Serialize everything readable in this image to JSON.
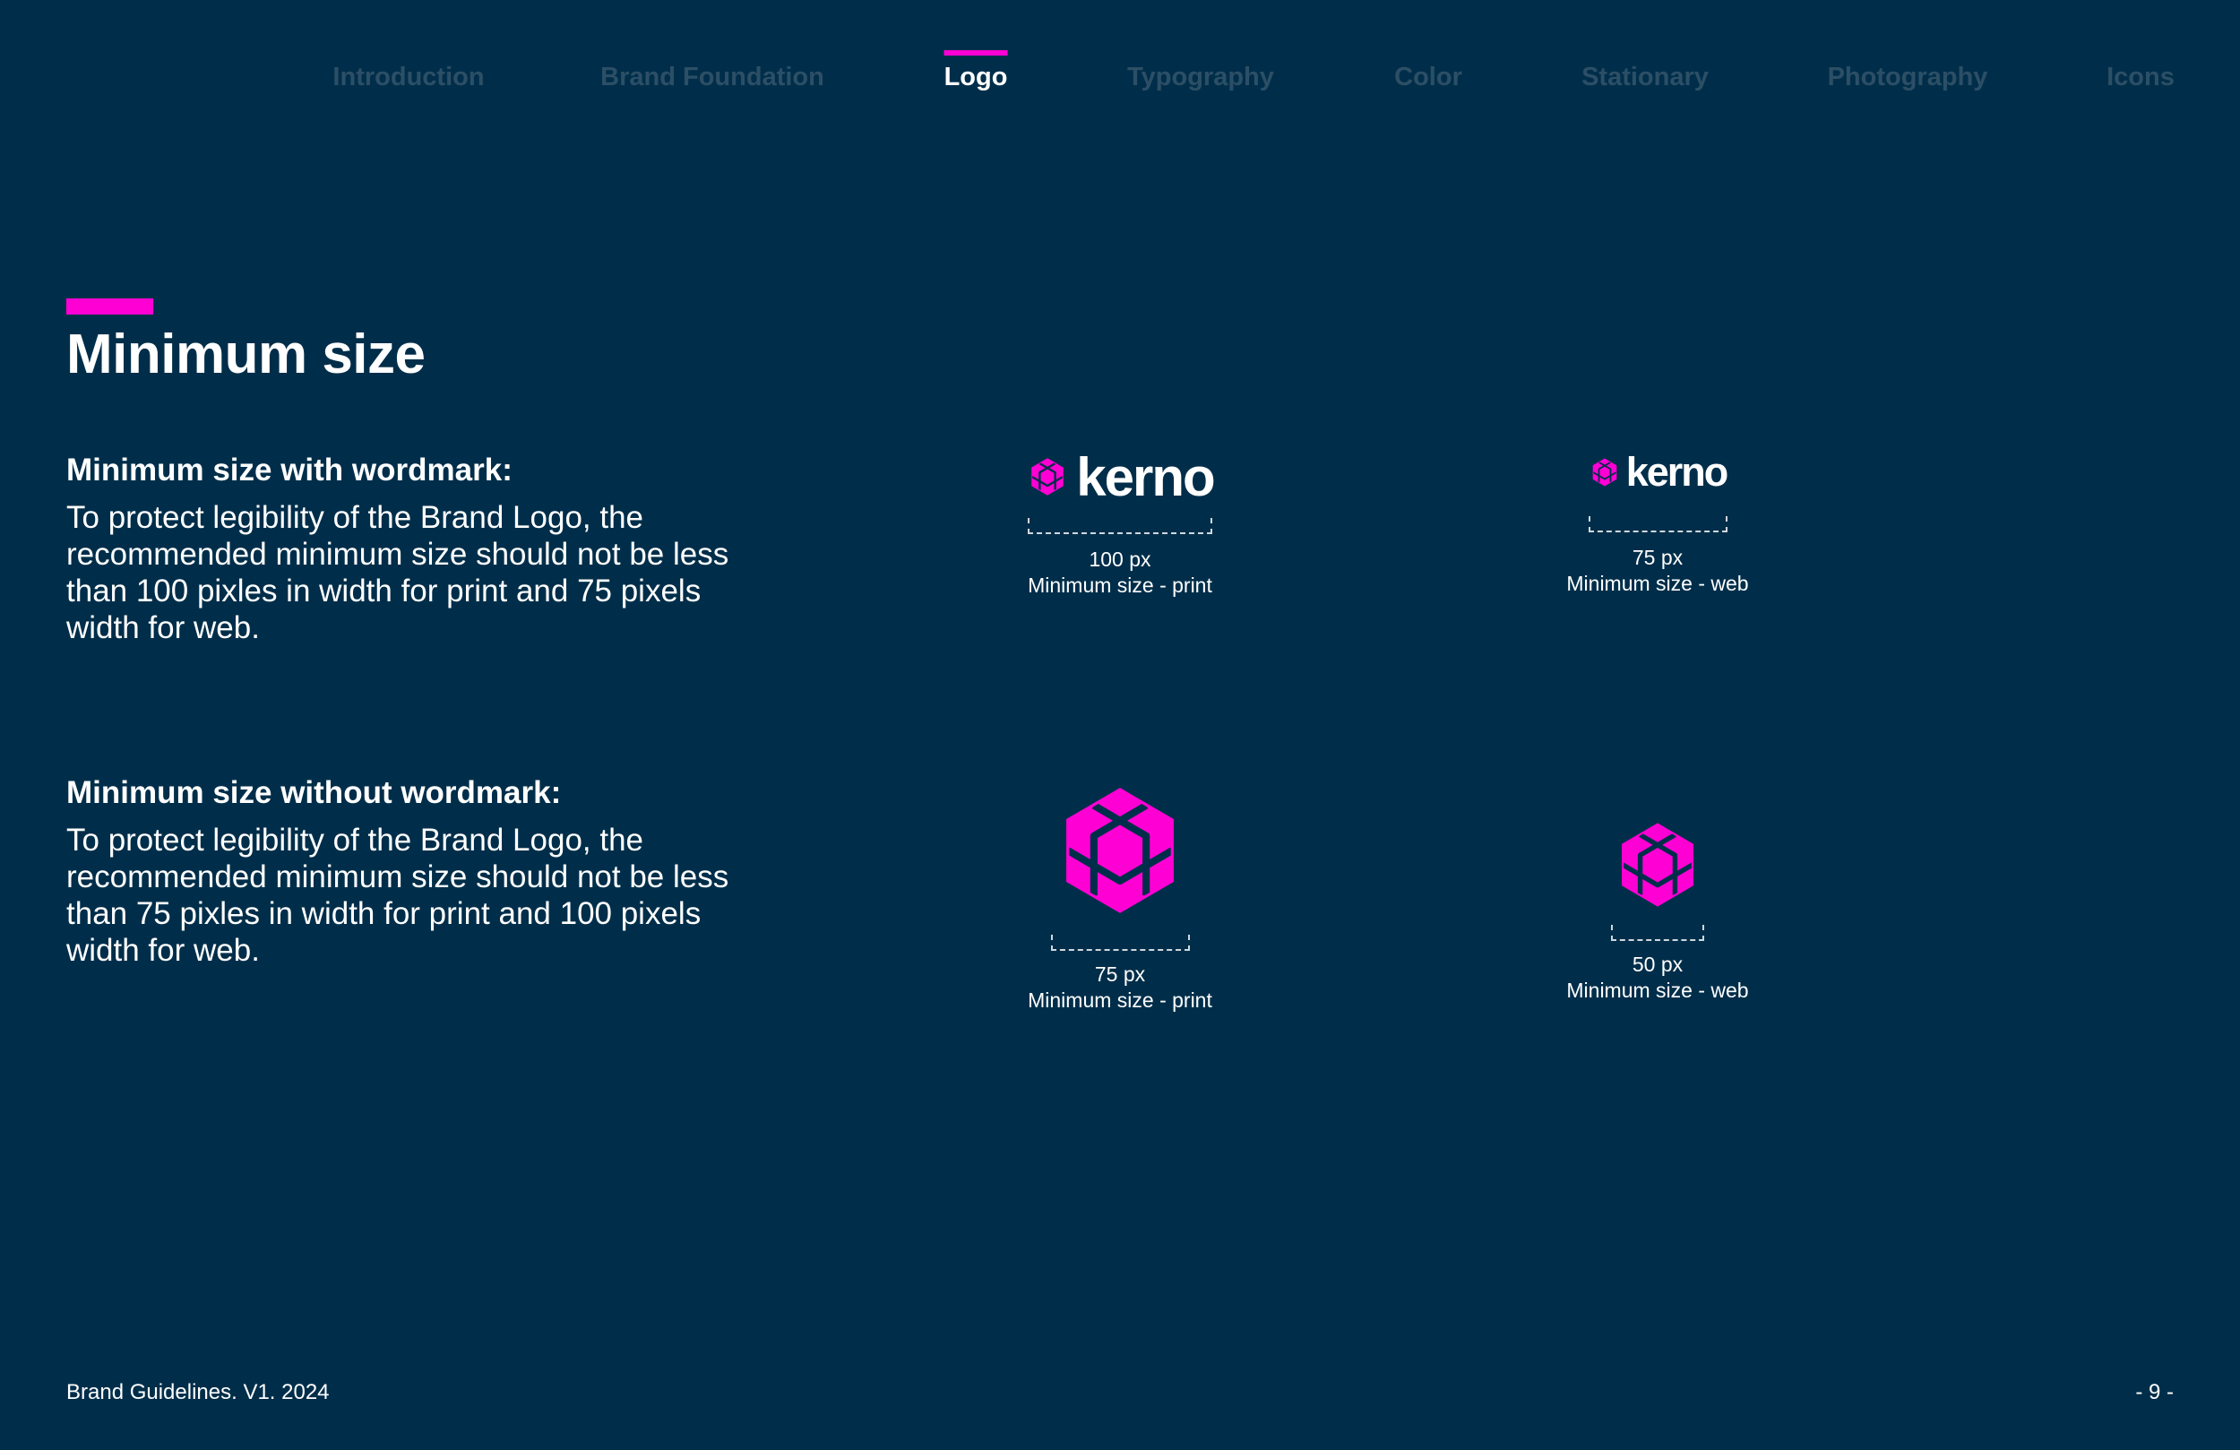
{
  "nav": {
    "items": [
      {
        "label": "Introduction",
        "active": false
      },
      {
        "label": "Brand Foundation",
        "active": false
      },
      {
        "label": "Logo",
        "active": true
      },
      {
        "label": "Typography",
        "active": false
      },
      {
        "label": "Color",
        "active": false
      },
      {
        "label": "Stationary",
        "active": false
      },
      {
        "label": "Photography",
        "active": false
      },
      {
        "label": "Icons",
        "active": false
      }
    ]
  },
  "page": {
    "title": "Minimum size"
  },
  "sections": [
    {
      "heading": "Minimum size with wordmark:",
      "body": "To protect legibility of the Brand Logo, the recommended minimum size should not be less than 100 pixles in width for print and 75 pixels width for web."
    },
    {
      "heading": "Minimum size without wordmark:",
      "body": "To protect legibility of the Brand Logo, the recommended minimum size should not be less than 75 pixles in width for print and 100 pixels width for web."
    }
  ],
  "logos": {
    "wordmark_text": "kerno",
    "examples": [
      {
        "size": "100 px",
        "label": "Minimum size - print"
      },
      {
        "size": "75 px",
        "label": "Minimum size - web"
      },
      {
        "size": "75 px",
        "label": "Minimum size - print"
      },
      {
        "size": "50 px",
        "label": "Minimum size - web"
      }
    ]
  },
  "footer": {
    "left": "Brand Guidelines. V1. 2024",
    "right": "- 9 -"
  },
  "colors": {
    "background": "#002e4a",
    "accent": "#ff00d4",
    "nav_inactive": "#2c4f66",
    "text": "#ffffff"
  }
}
